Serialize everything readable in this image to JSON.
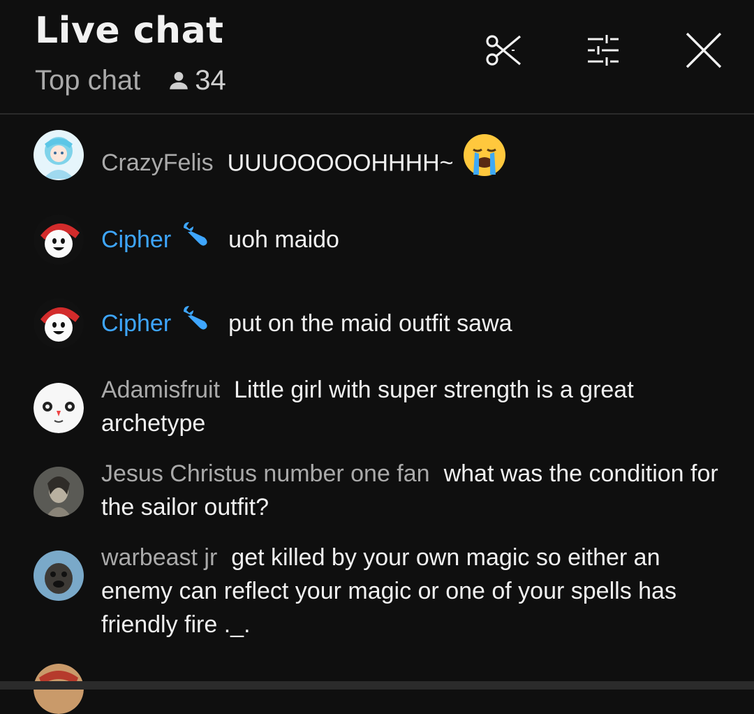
{
  "header": {
    "title": "Live chat",
    "mode": "Top chat",
    "viewer_count": "34",
    "icons": [
      "scissors-icon",
      "filter-sliders-icon",
      "close-icon"
    ]
  },
  "messages": [
    {
      "author": "CrazyFelis",
      "text": "UUUOOOOOHHHH~",
      "emoji": "loudly-crying-face",
      "moderator": false
    },
    {
      "author": "Cipher",
      "text": "uoh maido",
      "moderator": true
    },
    {
      "author": "Cipher",
      "text": "put on the maid outfit sawa",
      "moderator": true
    },
    {
      "author": "Adamisfruit",
      "text": "Little girl with super strength is a great archetype",
      "moderator": false
    },
    {
      "author": "Jesus Christus number one fan",
      "text": "what was the condition for the sailor outfit?",
      "moderator": false
    },
    {
      "author": "warbeast jr",
      "text": "get killed by your own magic so either an enemy can reflect your magic or one of your spells has friendly fire ._.",
      "moderator": false
    }
  ],
  "colors": {
    "background": "#0f0f0f",
    "author": "#aaaaaa",
    "moderator": "#3ea6ff",
    "text": "#f1f1f1"
  }
}
